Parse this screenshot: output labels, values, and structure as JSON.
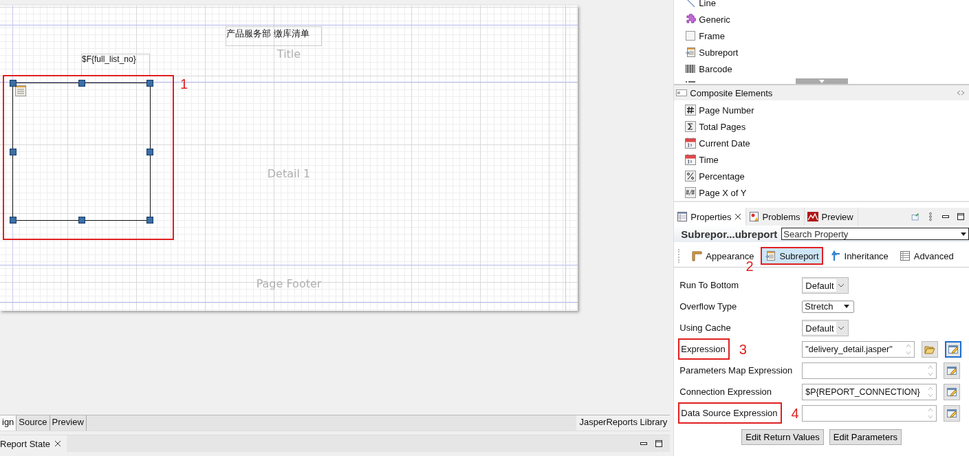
{
  "design_canvas": {
    "bands": [
      {
        "label": "Title"
      },
      {
        "label": "Detail 1"
      },
      {
        "label": "Page Footer"
      }
    ],
    "elements": [
      {
        "kind": "static_text",
        "text": "产品服务部 缴库清单"
      },
      {
        "kind": "text_field",
        "text": "$F{full_list_no}"
      },
      {
        "kind": "subreport",
        "selected": true,
        "annotation": "1"
      }
    ]
  },
  "editor_tabs": [
    {
      "label": "ign",
      "selected": true
    },
    {
      "label": "Source",
      "selected": false
    },
    {
      "label": "Preview",
      "selected": false
    }
  ],
  "library_label": "JasperReports Library",
  "bottom_panel": {
    "tab": "Report State"
  },
  "palette": {
    "items": [
      {
        "label": "Line",
        "kind": "line"
      },
      {
        "label": "Generic",
        "kind": "generic"
      },
      {
        "label": "Frame",
        "kind": "frame"
      },
      {
        "label": "Subreport",
        "kind": "subreport"
      },
      {
        "label": "Barcode",
        "kind": "barcode"
      },
      {
        "kind": "list"
      }
    ],
    "sections": [
      {
        "title": "Composite Elements",
        "items": [
          {
            "label": "Page Number",
            "kind": "hash"
          },
          {
            "label": "Total Pages",
            "kind": "sigma"
          },
          {
            "label": "Current Date",
            "kind": "calendar"
          },
          {
            "label": "Time",
            "kind": "calendar"
          },
          {
            "label": "Percentage",
            "kind": "percent"
          },
          {
            "label": "Page X of Y",
            "kind": "pagexy"
          }
        ]
      }
    ]
  },
  "properties": {
    "tabs": [
      {
        "label": "Properties",
        "selected": true,
        "kind": "properties"
      },
      {
        "label": "Problems",
        "selected": false,
        "kind": "problems"
      },
      {
        "label": "Preview",
        "selected": false,
        "kind": "preview"
      }
    ],
    "title": "Subrepor...ubreport",
    "search_placeholder": "Search Property",
    "sections": [
      {
        "label": "Appearance",
        "selected": false,
        "kind": "appearance"
      },
      {
        "label": "Subreport",
        "selected": true,
        "kind": "subreport",
        "annotation": "2"
      },
      {
        "label": "Inheritance",
        "selected": false,
        "kind": "inheritance"
      },
      {
        "label": "Advanced",
        "selected": false,
        "kind": "advanced"
      }
    ],
    "fields": [
      {
        "label": "Run To Bottom",
        "kind": "combo",
        "value": "Default"
      },
      {
        "label": "Overflow Type",
        "kind": "dropdown",
        "value": "Stretch"
      },
      {
        "label": "Using Cache",
        "kind": "combo",
        "value": "Default"
      },
      {
        "label": "Expression",
        "kind": "expression",
        "value": "\"delivery_detail.jasper\"",
        "browse": true,
        "annotation": "3"
      },
      {
        "label": "Parameters Map Expression",
        "kind": "expression",
        "browse": false
      },
      {
        "label": "Connection Expression",
        "kind": "expression",
        "value": "$P{REPORT_CONNECTION}",
        "browse": false
      },
      {
        "label": "Data Source Expression",
        "kind": "expression",
        "browse": false,
        "annotation": "4"
      }
    ],
    "buttons": [
      "Edit Return Values",
      "Edit Parameters"
    ]
  }
}
